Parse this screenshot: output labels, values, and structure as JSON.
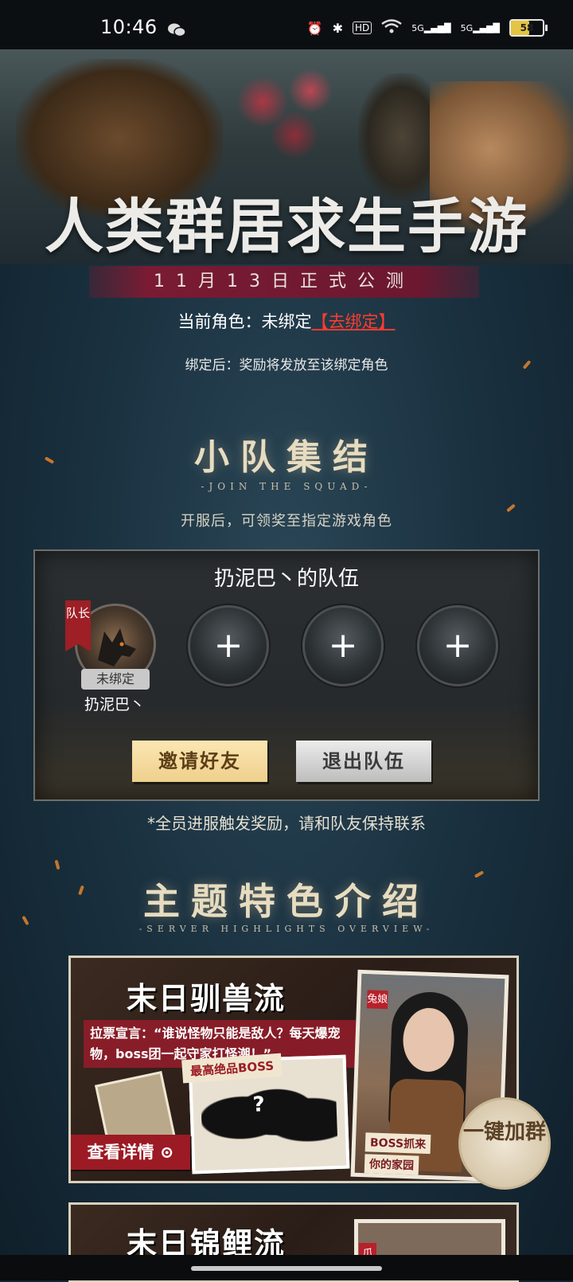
{
  "status_bar": {
    "time": "10:46",
    "battery": "58",
    "network_1": "5G",
    "network_2": "5G",
    "hd_label": "HD"
  },
  "hero": {
    "title": "人类群居求生手游",
    "date_banner": "11月13日正式公测"
  },
  "binding": {
    "current_role_label": "当前角色：",
    "current_role_value": "未绑定",
    "bind_link": "【去绑定】",
    "hint": "绑定后：奖励将发放至该绑定角色"
  },
  "squad_section": {
    "title": "小队集结",
    "subtitle": "-JOIN THE SQUAD-",
    "note": "开服后，可领奖至指定游戏角色",
    "team_name": "扔泥巴丶的队伍",
    "leader_tag": "队长",
    "leader_status": "未绑定",
    "leader_name": "扔泥巴丶",
    "empty_slot": "+",
    "invite_button": "邀请好友",
    "quit_button": "退出队伍",
    "footer_note": "*全员进服触发奖励，请和队友保持联系"
  },
  "features_section": {
    "title": "主题特色介绍",
    "subtitle": "-SERVER HIGHLIGHTS OVERVIEW-",
    "cards": [
      {
        "title": "末日驯兽流",
        "quote": "拉票宣言：“谁说怪物只能是敌人？每天爆宠物，boss团一起守家打怪潮！”",
        "boss_tag": "最高绝品BOSS",
        "boss_mark": "?",
        "portrait_name": "兔娘",
        "caption_1": "BOSS抓来",
        "caption_2": "你的家园",
        "detail_button": "查看详情 ⊙"
      },
      {
        "title": "末日锦鲤流",
        "portrait_name": "爪"
      }
    ],
    "join_group_badge": "一键加群"
  },
  "colors": {
    "accent_red": "#9b1a24",
    "link_red": "#ff3b30",
    "gold": "#efd08c"
  }
}
